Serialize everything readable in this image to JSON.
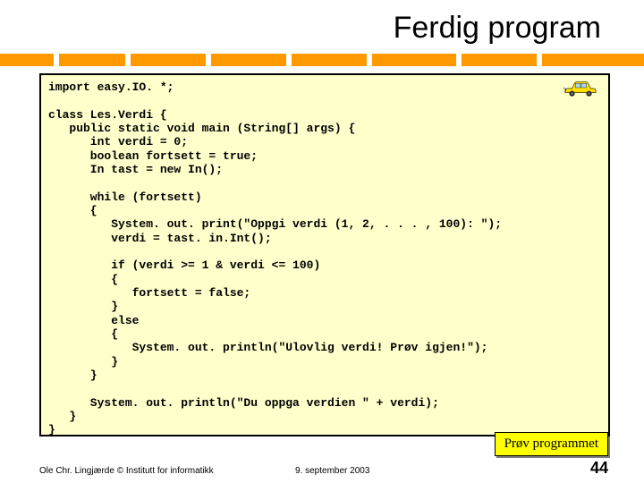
{
  "title": "Ferdig program",
  "code": "import easy.IO. *;\n\nclass Les.Verdi {\n   public static void main (String[] args) {\n      int verdi = 0;\n      boolean fortsett = true;\n      In tast = new In();\n\n      while (fortsett)\n      {\n         System. out. print(\"Oppgi verdi (1, 2, . . . , 100): \");\n         verdi = tast. in.Int();\n\n         if (verdi >= 1 & verdi <= 100)\n         {\n            fortsett = false;\n         }\n         else\n         {\n            System. out. println(\"Ulovlig verdi! Prøv igjen!\");\n         }\n      }\n\n      System. out. println(\"Du oppga verdien \" + verdi);\n   }\n}",
  "button": {
    "try_label": "Prøv programmet"
  },
  "footer": {
    "author": "Ole Chr. Lingjærde © Institutt for informatikk",
    "date": "9. september 2003",
    "page": "44"
  },
  "icons": {
    "car": "car-icon"
  }
}
